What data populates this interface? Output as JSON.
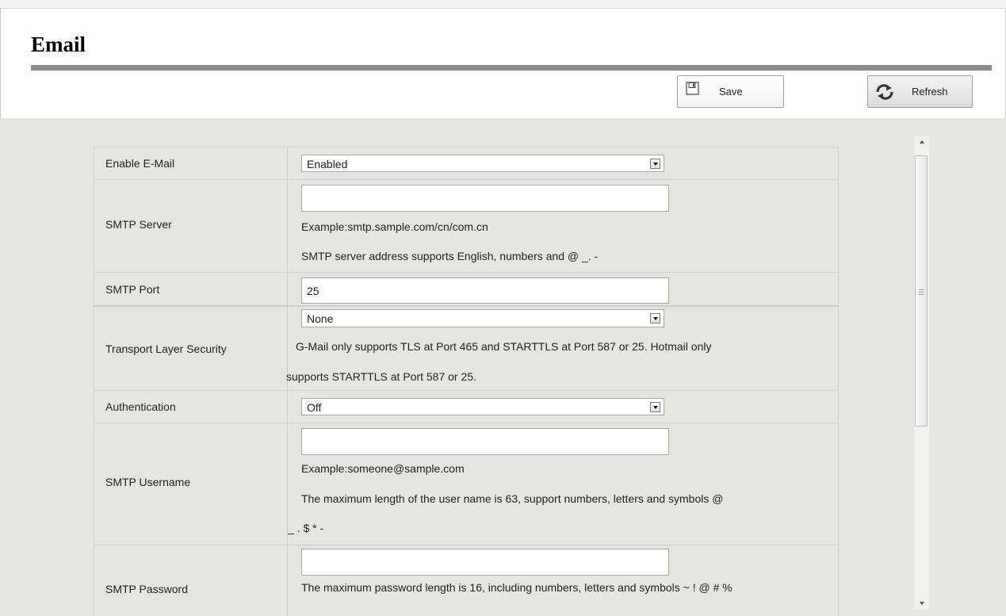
{
  "page": {
    "title": "Email"
  },
  "toolbar": {
    "save_label": "Save",
    "refresh_label": "Refresh",
    "save_icon": "floppy-disk-icon",
    "refresh_icon": "refresh-icon"
  },
  "form": {
    "enable_email": {
      "label": "Enable E-Mail",
      "value": "Enabled"
    },
    "smtp_server": {
      "label": "SMTP Server",
      "value": "",
      "example": "Example:smtp.sample.com/cn/com.cn",
      "hint": "SMTP server address supports English, numbers and @ _. -"
    },
    "smtp_port": {
      "label": "SMTP Port",
      "value": "25"
    },
    "tls": {
      "label": "Transport Layer Security",
      "value": "None",
      "hint_line1": "G-Mail only supports TLS at Port 465 and STARTTLS at Port 587 or 25. Hotmail only",
      "hint_line2": "supports STARTTLS at Port 587 or 25."
    },
    "authentication": {
      "label": "Authentication",
      "value": "Off"
    },
    "smtp_username": {
      "label": "SMTP Username",
      "value": "",
      "example": "Example:someone@sample.com",
      "hint_line1": "The maximum length of the user name is 63, support numbers, letters and symbols @",
      "hint_line2": "_ . $ * -"
    },
    "smtp_password": {
      "label": "SMTP Password",
      "value": "",
      "hint_line1": "The maximum password length is 16, including numbers, letters and symbols ~ ! @ # %"
    }
  },
  "colors": {
    "content_bg": "#e5e5e1",
    "title_rule": "#8c8c8c",
    "border": "#d0d0cc"
  }
}
